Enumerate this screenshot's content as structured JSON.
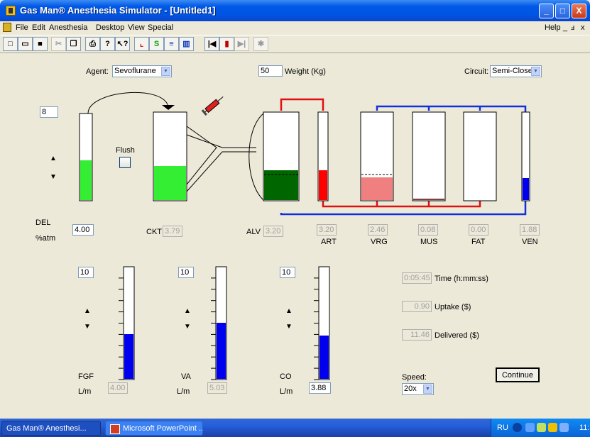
{
  "window": {
    "title": "Gas Man® Anesthesia Simulator - [Untitled1]",
    "minimize": "_",
    "maximize": "□",
    "close": "X"
  },
  "menu": {
    "items": [
      "File",
      "Edit",
      "Anesthesia",
      "Desktop",
      "View",
      "Special"
    ],
    "help": "Help",
    "mdi_min": "_",
    "mdi_restore": "ⅎ",
    "mdi_close": "x"
  },
  "toolbar": {
    "icons": [
      "new-icon",
      "open-icon",
      "save-icon",
      "cut-icon",
      "copy-icon",
      "print-icon",
      "about-icon",
      "context-help-icon",
      "graph-icon",
      "summary-icon",
      "table-icon",
      "overlay-icon",
      "rewind-icon",
      "pause-icon",
      "step-icon",
      "syringe-settings-icon"
    ]
  },
  "controls": {
    "agent_label": "Agent:",
    "agent_value": "Sevoflurane",
    "weight_value": "50",
    "weight_label": "Weight (Kg)",
    "circuit_label": "Circuit:",
    "circuit_value": "Semi-Closed"
  },
  "vaporizer": {
    "setting": "8",
    "flush_label": "Flush",
    "del_label": "DEL",
    "atm_label": "%atm",
    "del_value": "4.00",
    "fill_fraction": 0.46
  },
  "compartments": {
    "ckt": {
      "label": "CKT",
      "value": "3.79",
      "fill_fraction": 0.39
    },
    "alv": {
      "label": "ALV",
      "value": "3.20",
      "fill_fraction": 0.34
    },
    "art": {
      "label": "ART",
      "value": "3.20",
      "fill_fraction": 0.34
    },
    "vrg": {
      "label": "VRG",
      "value": "2.46",
      "fill_fraction": 0.26
    },
    "mus": {
      "label": "MUS",
      "value": "0.08",
      "fill_fraction": 0.02
    },
    "fat": {
      "label": "FAT",
      "value": "0.00",
      "fill_fraction": 0.0
    },
    "ven": {
      "label": "VEN",
      "value": "1.88",
      "fill_fraction": 0.25
    }
  },
  "flows": {
    "fgf": {
      "label": "FGF",
      "unit": "L/m",
      "setting": "10",
      "value": "4.00",
      "fill_fraction": 0.4
    },
    "va": {
      "label": "VA",
      "unit": "L/m",
      "setting": "10",
      "value": "5.03",
      "fill_fraction": 0.5
    },
    "co": {
      "label": "CO",
      "unit": "L/m",
      "setting": "10",
      "value": "3.88",
      "fill_fraction": 0.39
    }
  },
  "stats": {
    "time_value": "0:05:45",
    "time_label": "Time (h:mm:ss)",
    "uptake_value": "0.90",
    "uptake_label": "Uptake ($)",
    "delivered_value": "11.46",
    "delivered_label": "Delivered ($)"
  },
  "speed": {
    "label": "Speed:",
    "value": "20x"
  },
  "continue_button": "Continue",
  "taskbar": {
    "task1": "Gas Man® Anesthesi...",
    "task2": "Microsoft PowerPoint ...",
    "lang": "RU",
    "clock": "11:"
  },
  "colors": {
    "green": "#33ee33",
    "dark_green": "#006600",
    "red": "#ff0000",
    "pink": "#f08080",
    "blue": "#0000ee",
    "circuit_blue": "#1030e0",
    "circuit_red": "#e01010"
  }
}
